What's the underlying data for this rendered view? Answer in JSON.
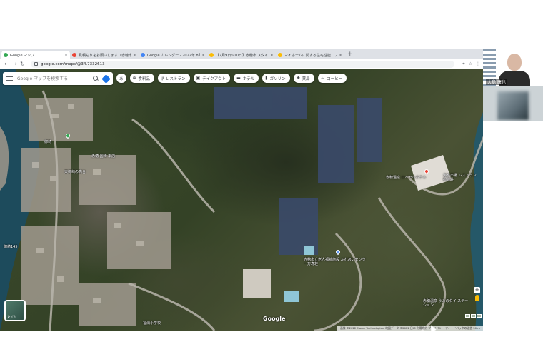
{
  "browser": {
    "tabs": [
      {
        "title": "Google マップ",
        "favicon_color": "#34a853",
        "active": true
      },
      {
        "title": "見積もりをお願いします（赤穂市か",
        "favicon_color": "#ea4335",
        "active": false
      },
      {
        "title": "Google カレンダー - 2022年 8月 19",
        "favicon_color": "#4285f4",
        "active": false
      },
      {
        "title": "【7月9日~10日】赤穂市 スタイリッシュ",
        "favicon_color": "#fbbc04",
        "active": false
      },
      {
        "title": "マイホームに関する住宅性能...フラン",
        "favicon_color": "#fbbc04",
        "active": false
      }
    ],
    "url": "google.com/maps/@34.7332613",
    "nav": {
      "back": "←",
      "forward": "→",
      "reload": "↻"
    }
  },
  "map": {
    "search_placeholder": "Google マップを検索する",
    "chips": [
      {
        "label": "あ",
        "icon": "language-icon"
      },
      {
        "label": "食料品",
        "icon": "cart-icon"
      },
      {
        "label": "レストラン",
        "icon": "restaurant-icon"
      },
      {
        "label": "テイクアウト",
        "icon": "takeout-icon"
      },
      {
        "label": "ホテル",
        "icon": "hotel-icon"
      },
      {
        "label": "ガソリン",
        "icon": "gas-icon"
      },
      {
        "label": "薬局",
        "icon": "pharmacy-icon"
      },
      {
        "label": "コーヒー",
        "icon": "coffee-icon"
      }
    ],
    "labels": {
      "resort": "赤穂市立老人福祉施設 ふれあいセンター万寿荘",
      "restaurant": "海鮮市場 レストラン 銀波荘",
      "lodge": "赤穂温泉 ロイヤルホテル",
      "house": "赤穂温泉 うみのタイ ステーション",
      "shrine": "御崎",
      "shop": "赤穂 国崎 本店",
      "bus_stop": "御崎145",
      "park": "東御崎の高台",
      "school": "福浦小学校"
    },
    "layers_label": "レイヤ",
    "logo": "Google",
    "attribution": "画像 ©2022 Maxar Technologies, 地図データ ©2022 日本 利用規約 プライバシー フィードバックの送信 50 m"
  },
  "video": {
    "presenter_name": "大島 康也",
    "colors": {
      "tile_bg": "#ffffff",
      "participant_bg": "#ccd3d6"
    }
  },
  "colors": {
    "accent": "#1a73e8",
    "tabbar": "#dee1e6"
  }
}
